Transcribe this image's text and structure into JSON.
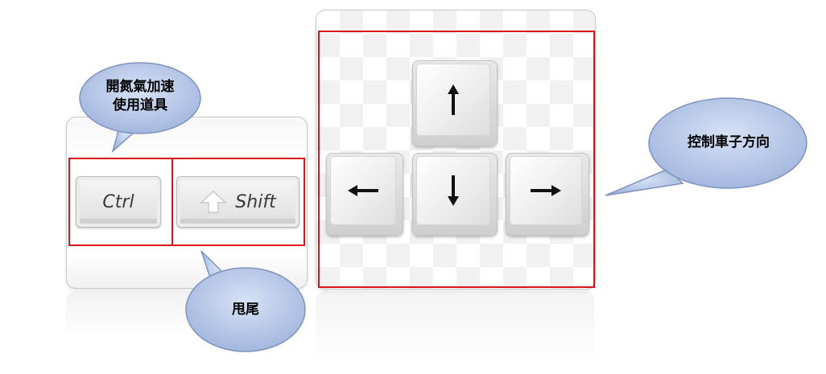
{
  "keyboard_left": {
    "ctrl_label": "Ctrl",
    "shift_label": "Shift"
  },
  "callouts": {
    "ctrl_line1": "開氮氣加速",
    "ctrl_line2": "使用道具",
    "shift": "甩尾",
    "arrows": "控制車子方向"
  },
  "icons": {
    "shift": "shift-arrow-icon",
    "up": "arrow-up-icon",
    "down": "arrow-down-icon",
    "left": "arrow-left-icon",
    "right": "arrow-right-icon"
  },
  "colors": {
    "highlight": "#d9141b",
    "bubble_fill": "#b8c8e8",
    "bubble_stroke": "#7f93bf"
  }
}
